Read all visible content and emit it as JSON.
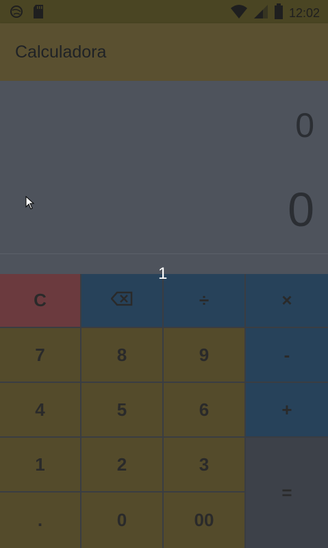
{
  "status_bar": {
    "time": "12:02",
    "icons": [
      "globe-icon",
      "sd-card-icon",
      "wifi-icon",
      "signal-icon",
      "battery-icon"
    ]
  },
  "app_bar": {
    "title": "Calculadora"
  },
  "display": {
    "expression": "0",
    "result": "0"
  },
  "tooltip": {
    "text": "1"
  },
  "keys": {
    "clear": "C",
    "backspace": "⌫",
    "divide": "÷",
    "multiply": "×",
    "seven": "7",
    "eight": "8",
    "nine": "9",
    "minus": "-",
    "four": "4",
    "five": "5",
    "six": "6",
    "plus": "+",
    "one": "1",
    "two": "2",
    "three": "3",
    "equals": "=",
    "dot": ".",
    "zero": "0",
    "double_zero": "00"
  },
  "colors": {
    "number_key": "#544b2b",
    "operator_key": "#27425a",
    "clear_key": "#6b3a3e",
    "equals_key": "#3d4149",
    "display_bg": "#4e535c",
    "appbar_bg": "#5a5030"
  }
}
